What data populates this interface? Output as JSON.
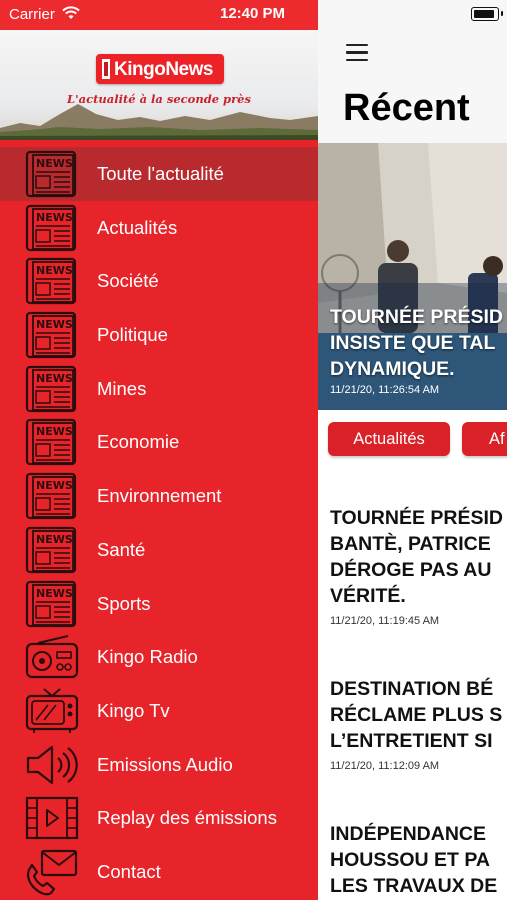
{
  "status": {
    "carrier": "Carrier",
    "time": "12:40 PM"
  },
  "brand": {
    "logo": "KingoNews",
    "tagline": "L'actualité à la seconde près"
  },
  "menu": [
    {
      "label": "Toute l'actualité",
      "icon": "newspaper-icon"
    },
    {
      "label": "Actualités",
      "icon": "newspaper-icon"
    },
    {
      "label": "Société",
      "icon": "newspaper-icon"
    },
    {
      "label": "Politique",
      "icon": "newspaper-icon"
    },
    {
      "label": "Mines",
      "icon": "newspaper-icon"
    },
    {
      "label": "Economie",
      "icon": "newspaper-icon"
    },
    {
      "label": "Environnement",
      "icon": "newspaper-icon"
    },
    {
      "label": "Santé",
      "icon": "newspaper-icon"
    },
    {
      "label": "Sports",
      "icon": "newspaper-icon"
    },
    {
      "label": "Kingo Radio",
      "icon": "radio-icon"
    },
    {
      "label": "Kingo Tv",
      "icon": "tv-icon"
    },
    {
      "label": "Emissions Audio",
      "icon": "speaker-icon"
    },
    {
      "label": "Replay des émissions",
      "icon": "video-icon"
    },
    {
      "label": "Contact",
      "icon": "contact-icon"
    }
  ],
  "content": {
    "title": "Récent",
    "hero": {
      "title_lines": [
        "TOURNÉE PRÉSID",
        "INSISTE QUE TAL",
        "DYNAMIQUE."
      ],
      "date": "11/21/20, 11:26:54 AM"
    },
    "categories": [
      "Actualités",
      "Af"
    ],
    "articles": [
      {
        "title": "TOURNÉE PRÉSID\nBANTÈ, PATRICE\nDÉROGE PAS AU\nVÉRITÉ.",
        "date": "11/21/20, 11:19:45 AM"
      },
      {
        "title": "DESTINATION BÉ\nRÉCLAME PLUS S\nL’ENTRETIENT SI",
        "date": "11/21/20, 11:12:09 AM"
      },
      {
        "title": "INDÉPENDANCE\nHOUSSOU ET PA\nLES TRAVAUX DE",
        "date": ""
      }
    ]
  },
  "colors": {
    "brand_red": "#e8242b",
    "active_red": "#b92a2f",
    "chip_red": "#d92127"
  }
}
